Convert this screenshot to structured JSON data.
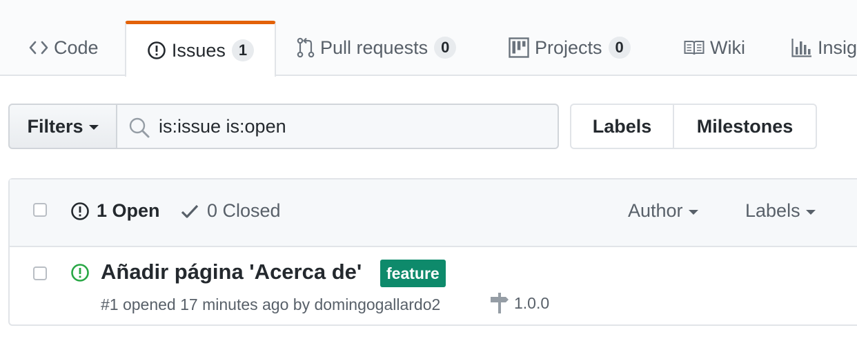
{
  "repo_nav": {
    "tabs": [
      {
        "label": "Code",
        "icon": "code-icon",
        "counter": null
      },
      {
        "label": "Issues",
        "icon": "issue-opened-icon",
        "counter": "1",
        "selected": true
      },
      {
        "label": "Pull requests",
        "icon": "git-pull-request-icon",
        "counter": "0"
      },
      {
        "label": "Projects",
        "icon": "project-icon",
        "counter": "0"
      },
      {
        "label": "Wiki",
        "icon": "book-icon",
        "counter": null
      },
      {
        "label": "Insig",
        "icon": "graph-icon",
        "counter": null
      }
    ],
    "accent_color": "#e36209"
  },
  "filter_bar": {
    "filters_label": "Filters",
    "search_value": "is:issue is:open",
    "labels_button": "Labels",
    "milestones_button": "Milestones"
  },
  "issues_header": {
    "open_label": "1 Open",
    "closed_label": "0 Closed",
    "author_dropdown": "Author",
    "labels_dropdown": "Labels"
  },
  "issues": [
    {
      "title": "Añadir página 'Acerca de'",
      "label": {
        "name": "feature",
        "color": "#0e8a6b"
      },
      "meta": "#1 opened 17 minutes ago by domingogallardo2",
      "milestone": "1.0.0",
      "status_color": "#28a745"
    }
  ]
}
